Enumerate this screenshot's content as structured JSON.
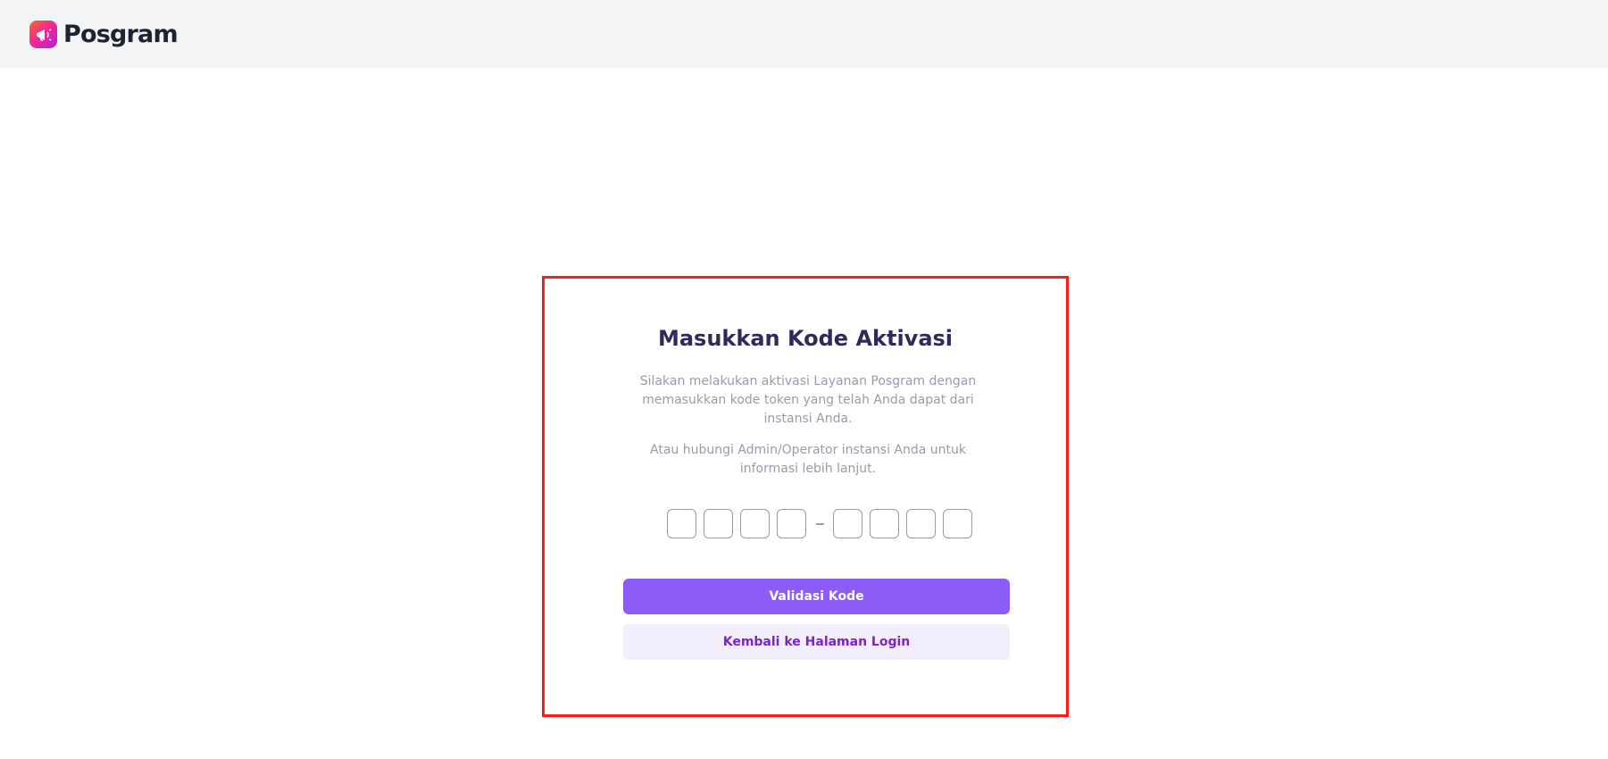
{
  "app": {
    "name": "Posgram",
    "logo_icon": "megaphone-icon",
    "logo_colors": [
      "#ff6a2b",
      "#f02b8f",
      "#b51de0"
    ]
  },
  "activation": {
    "title": "Masukkan Kode Aktivasi",
    "description": "Silakan melakukan aktivasi Layanan Posgram dengan memasukkan kode token yang telah Anda dapat dari instansi Anda.",
    "contact_note": "Atau hubungi Admin/Operator instansi Anda untuk informasi lebih lanjut.",
    "code_separator": "–",
    "code_digits": [
      "",
      "",
      "",
      "",
      "",
      "",
      "",
      ""
    ],
    "validate_button": "Validasi Kode",
    "back_button": "Kembali ke Halaman Login"
  },
  "colors": {
    "primary": "#8b5cf6",
    "secondary_bg": "#f3eefb",
    "secondary_text": "#7e22ce",
    "title": "#2f2a5c",
    "highlight_border": "#ff1a1a"
  }
}
